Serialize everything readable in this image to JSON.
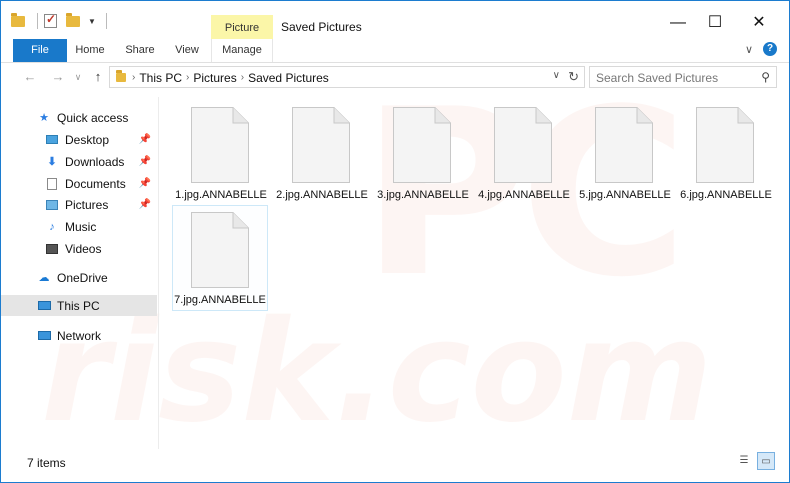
{
  "window": {
    "title": "Saved Pictures",
    "context_tab_group": "Picture Tools",
    "minimize_glyph": "—",
    "maximize_glyph": "☐",
    "close_glyph": "✕"
  },
  "ribbon": {
    "tabs": [
      {
        "label": "File",
        "active": true
      },
      {
        "label": "Home"
      },
      {
        "label": "Share"
      },
      {
        "label": "View"
      },
      {
        "label": "Manage"
      }
    ],
    "help_glyph": "?",
    "expand_glyph": "∨"
  },
  "address": {
    "crumbs": [
      "This PC",
      "Pictures",
      "Saved Pictures"
    ],
    "separator": "›",
    "search_placeholder": "Search Saved Pictures"
  },
  "nav": {
    "quick_access": "Quick access",
    "items": [
      {
        "label": "Desktop",
        "icon": "desktop-icon",
        "pinned": true
      },
      {
        "label": "Downloads",
        "icon": "downloads-icon",
        "pinned": true
      },
      {
        "label": "Documents",
        "icon": "documents-icon",
        "pinned": true
      },
      {
        "label": "Pictures",
        "icon": "pictures-icon",
        "pinned": true
      },
      {
        "label": "Music",
        "icon": "music-icon"
      },
      {
        "label": "Videos",
        "icon": "videos-icon"
      }
    ],
    "onedrive": "OneDrive",
    "this_pc": "This PC",
    "network": "Network"
  },
  "files": [
    {
      "name": "1.jpg.ANNABELLE"
    },
    {
      "name": "2.jpg.ANNABELLE"
    },
    {
      "name": "3.jpg.ANNABELLE"
    },
    {
      "name": "4.jpg.ANNABELLE"
    },
    {
      "name": "5.jpg.ANNABELLE"
    },
    {
      "name": "6.jpg.ANNABELLE"
    },
    {
      "name": "7.jpg.ANNABELLE",
      "selected": true
    }
  ],
  "status": {
    "item_count": "7 items"
  },
  "colors": {
    "accent": "#1979ca",
    "picture_tools": "#fbf6a8",
    "selection": "#e5e5e5"
  },
  "watermark": {
    "top": "PC",
    "bottom": "risk.com"
  }
}
